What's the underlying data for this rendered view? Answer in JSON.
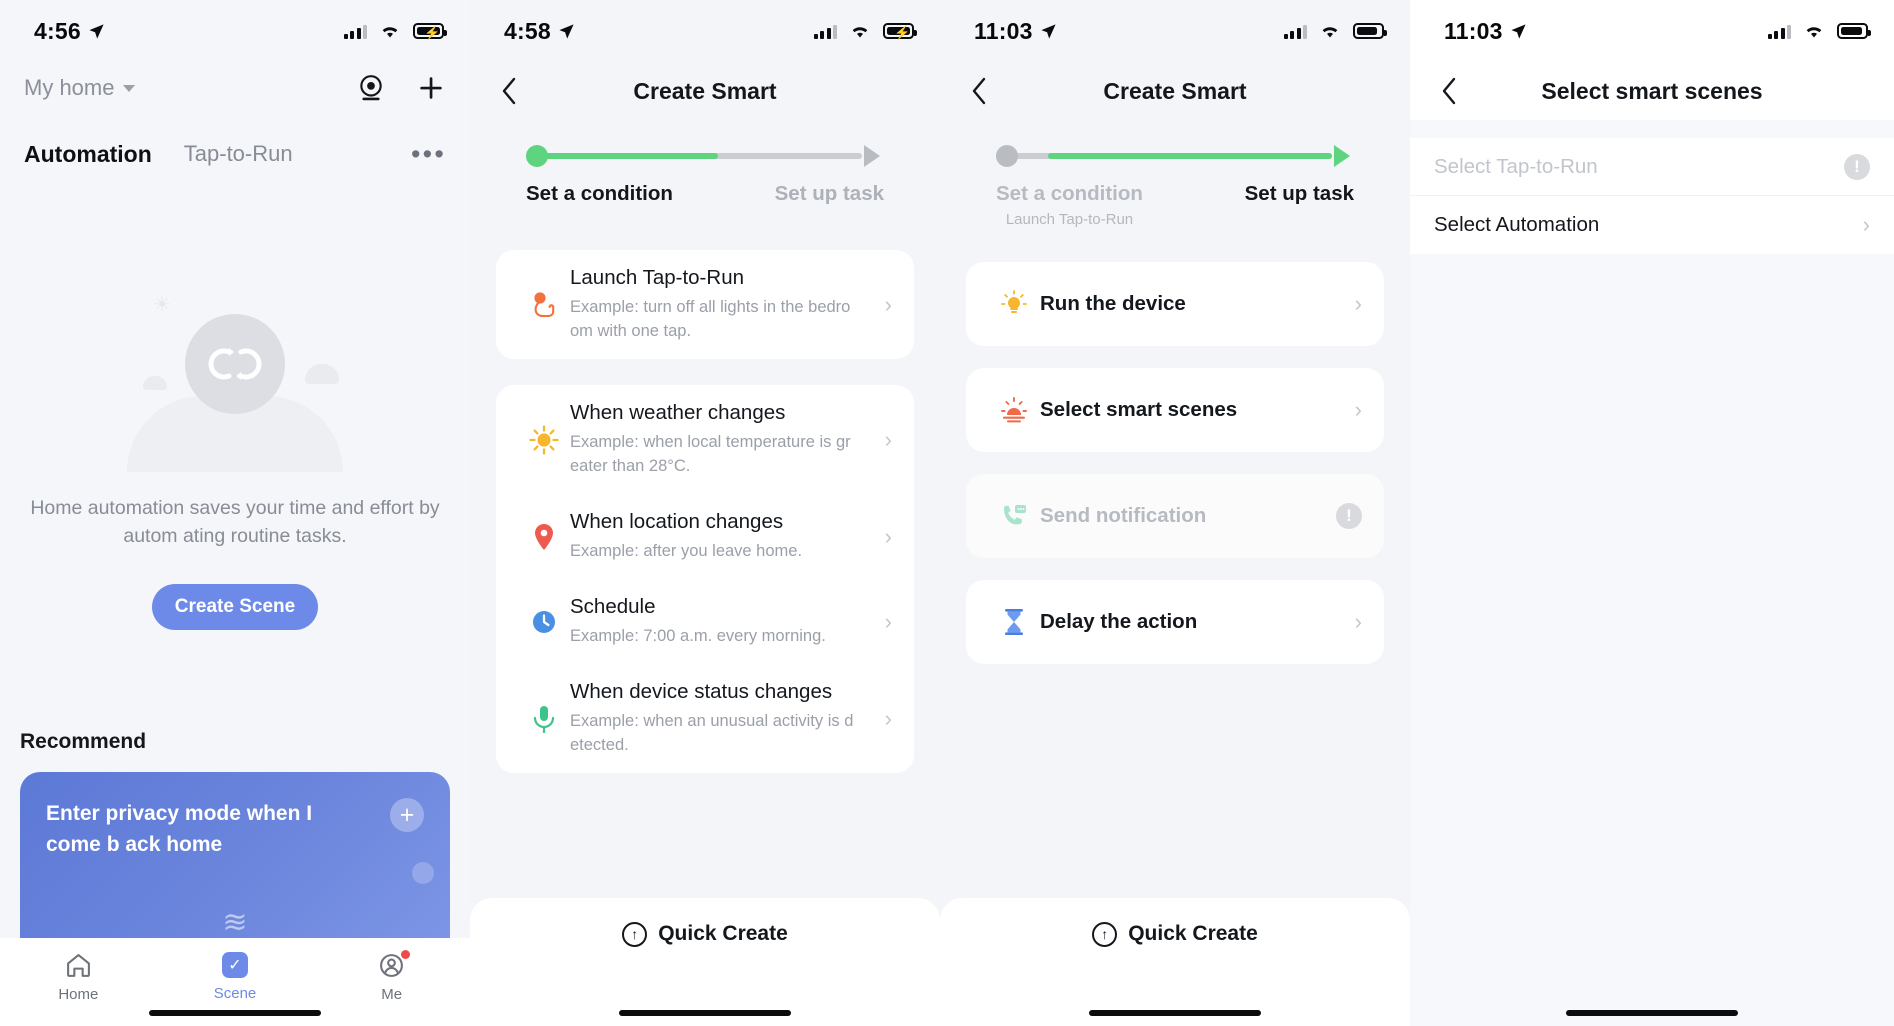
{
  "panel1": {
    "status": {
      "time": "4:56",
      "location_icon": "location-arrow-icon",
      "battery_icon": "battery-charging-icon"
    },
    "home_selector": "My home",
    "icons": {
      "scan": "scan-icon",
      "add": "plus-icon",
      "more": "more-options-icon"
    },
    "tabs": [
      {
        "label": "Automation",
        "active": true
      },
      {
        "label": "Tap-to-Run",
        "active": false
      }
    ],
    "empty_state": {
      "text": "Home automation saves your time and effort by autom ating routine tasks.",
      "button": "Create Scene"
    },
    "recommend": {
      "heading": "Recommend",
      "card_title": "Enter privacy mode when I come b ack home",
      "add_icon": "plus-circle-icon"
    },
    "tabbar": [
      {
        "label": "Home",
        "icon": "home-icon",
        "active": false,
        "badge": false
      },
      {
        "label": "Scene",
        "icon": "check-square-icon",
        "active": true,
        "badge": false
      },
      {
        "label": "Me",
        "icon": "account-icon",
        "active": false,
        "badge": true
      }
    ]
  },
  "panel2": {
    "status": {
      "time": "4:58"
    },
    "nav": {
      "back": "back-chevron-icon",
      "title": "Create Smart"
    },
    "stepper": {
      "steps": [
        {
          "label": "Set a condition",
          "active": true
        },
        {
          "label": "Set up task",
          "active": false
        }
      ],
      "active_color": "#5ed47f",
      "inactive_color": "#c9cbd0"
    },
    "conditions": [
      {
        "title": "Launch Tap-to-Run",
        "desc": "Example: turn off all lights in the bedro om with one tap.",
        "icon": "tap-hand-icon",
        "color": "#f2723f"
      },
      {
        "title": "When weather changes",
        "desc": "Example: when local temperature is gr eater than 28°C.",
        "icon": "sun-icon",
        "color": "#f8b62c"
      },
      {
        "title": "When location changes",
        "desc": "Example: after you leave home.",
        "icon": "location-pin-icon",
        "color": "#ee5a4e"
      },
      {
        "title": "Schedule",
        "desc": "Example: 7:00 a.m. every morning.",
        "icon": "clock-icon",
        "color": "#4a90e2"
      },
      {
        "title": "When device status changes",
        "desc": "Example: when an unusual activity is d etected.",
        "icon": "sensor-icon",
        "color": "#3cc48a"
      }
    ],
    "quick_create": {
      "label": "Quick Create",
      "icon": "upload-circle-icon"
    }
  },
  "panel3": {
    "status": {
      "time": "11:03"
    },
    "nav": {
      "back": "back-chevron-icon",
      "title": "Create Smart"
    },
    "stepper": {
      "steps": [
        {
          "label": "Set a condition",
          "sub": "Launch Tap-to-Run",
          "active": false
        },
        {
          "label": "Set up task",
          "sub": "",
          "active": true
        }
      ],
      "active_color": "#5ed47f",
      "inactive_color": "#c9cbd0"
    },
    "tasks": [
      {
        "title": "Run the device",
        "icon": "bulb-icon",
        "disabled": false
      },
      {
        "title": "Select smart scenes",
        "icon": "sunrise-icon",
        "disabled": false
      },
      {
        "title": "Send notification",
        "icon": "phone-message-icon",
        "disabled": true
      },
      {
        "title": "Delay the action",
        "icon": "hourglass-icon",
        "disabled": false
      }
    ],
    "quick_create": {
      "label": "Quick Create",
      "icon": "upload-circle-icon"
    }
  },
  "panel4": {
    "status": {
      "time": "11:03"
    },
    "nav": {
      "back": "back-chevron-icon",
      "title": "Select smart scenes"
    },
    "options": [
      {
        "label": "Select Tap-to-Run",
        "disabled": true,
        "trailing": "info-icon"
      },
      {
        "label": "Select Automation",
        "disabled": false,
        "trailing": "chevron-right-icon"
      }
    ]
  }
}
